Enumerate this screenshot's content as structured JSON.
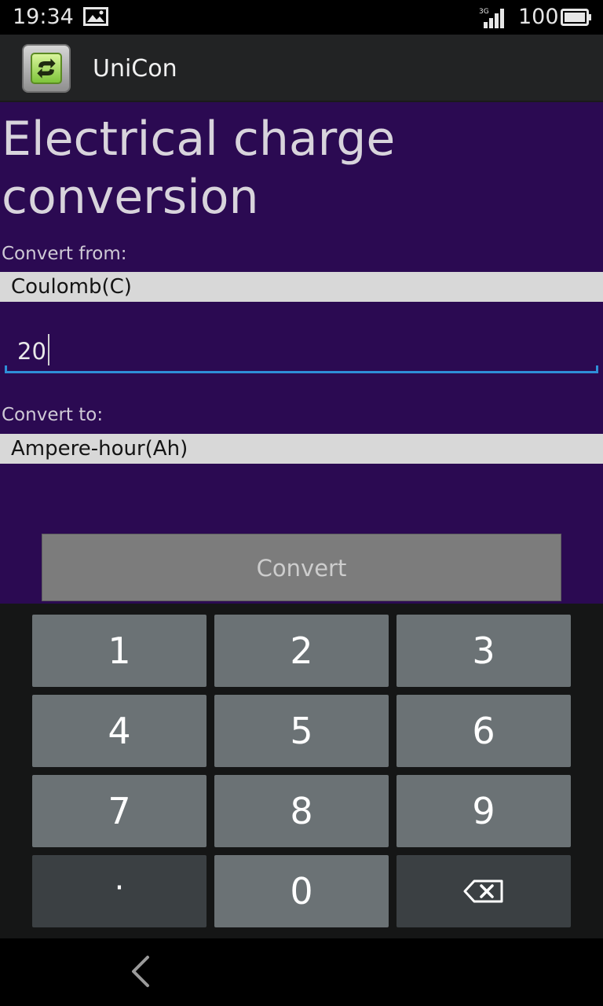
{
  "status_bar": {
    "time": "19:34",
    "network": "3G",
    "battery": "100",
    "icons": [
      "gallery-icon",
      "signal-icon",
      "battery-icon"
    ]
  },
  "app_bar": {
    "title": "UniCon",
    "icon": "refresh-icon"
  },
  "converter": {
    "title": "Electrical charge conversion",
    "from_label": "Convert from:",
    "from_unit": "Coulomb(C)",
    "value": "20",
    "to_label": "Convert to:",
    "to_unit": "Ampere-hour(Ah)",
    "convert_label": "Convert"
  },
  "keypad": {
    "k1": "1",
    "k2": "2",
    "k3": "3",
    "k4": "4",
    "k5": "5",
    "k6": "6",
    "k7": "7",
    "k8": "8",
    "k9": "9",
    "dot": "·",
    "k0": "0",
    "backspace_icon": "backspace-icon"
  },
  "nav_bar": {
    "back_icon": "back-chevron-icon"
  },
  "colors": {
    "content_bg": "#2b0a52",
    "input_underline": "#2f8fd8",
    "button_bg": "#7c7c7c",
    "key_bg": "#6b7275"
  }
}
